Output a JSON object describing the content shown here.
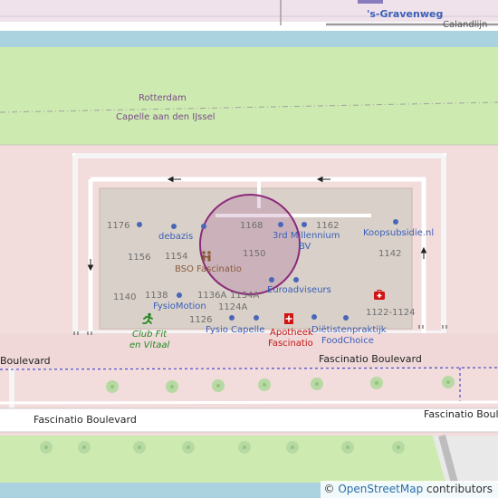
{
  "map": {
    "top_street": "'s-Gravenweg",
    "waterway": "Calandlijn",
    "boundary_north": "Rotterdam",
    "boundary_south": "Capelle aan den IJssel",
    "street_left": "Boulevard",
    "street_center": "Fascinatio Boulevard",
    "road_left": "Fascinatio Boulevard",
    "road_right": "Fascinatio Boul",
    "search_radius_circle": true
  },
  "house_numbers": [
    "1176",
    "1168",
    "1162",
    "1156",
    "1154",
    "1150",
    "1142",
    "1140",
    "1138",
    "1136A",
    "1134A",
    "1124A",
    "1126",
    "1122-1124"
  ],
  "pois": {
    "debazis": "debazis",
    "millennium_1": "3rd Millennium",
    "millennium_2": "BV",
    "koopsubsidie": "Koopsubsidie.nl",
    "bso": "BSO Fascinatio",
    "euroadviseurs": "Euroadviseurs",
    "fysiomotion": "FysioMotion",
    "fysio_capelle": "Fysio Capelle",
    "apotheek_1": "Apotheek",
    "apotheek_2": "Fascinatio",
    "dietist_1": "Diëtistenpraktijk",
    "dietist_2": "FoodChoice",
    "clubfit_1": "Club Fit",
    "clubfit_2": "en Vitaal"
  },
  "icons": {
    "childcare": "childcare-icon",
    "pharmacy": "pharmacy-icon",
    "clinic": "first-aid-icon",
    "fitness": "fitness-icon"
  },
  "colors": {
    "residential": "#f2dcdc",
    "grass": "#cdebb0",
    "water": "#aad3df",
    "building": "#d9d0c9",
    "footway": "#ffffff",
    "circle": "#8b2a7b"
  },
  "attribution": {
    "copyright": "©",
    "link": "OpenStreetMap",
    "suffix": " contributors"
  }
}
